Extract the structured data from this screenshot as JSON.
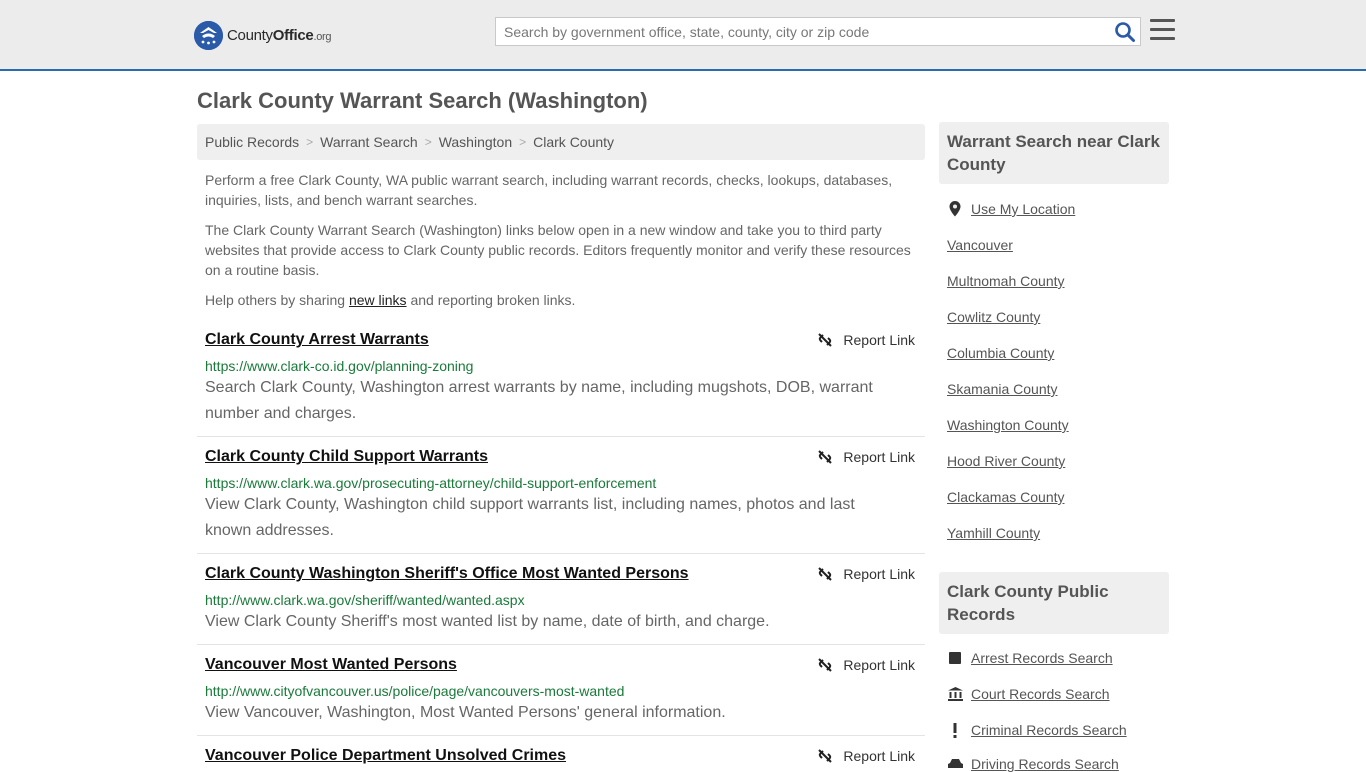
{
  "header": {
    "logo_county": "County",
    "logo_office": "Office",
    "logo_org": ".org",
    "search_placeholder": "Search by government office, state, county, city or zip code"
  },
  "page_title": "Clark County Warrant Search (Washington)",
  "breadcrumb": [
    "Public Records",
    "Warrant Search",
    "Washington",
    "Clark County"
  ],
  "intro": {
    "p1": "Perform a free Clark County, WA public warrant search, including warrant records, checks, lookups, databases, inquiries, lists, and bench warrant searches.",
    "p2": "The Clark County Warrant Search (Washington) links below open in a new window and take you to third party websites that provide access to Clark County public records. Editors frequently monitor and verify these resources on a routine basis.",
    "p3_before": "Help others by sharing ",
    "p3_link": "new links",
    "p3_after": " and reporting broken links."
  },
  "report_label": "Report Link",
  "results": [
    {
      "title": "Clark County Arrest Warrants",
      "url": "https://www.clark-co.id.gov/planning-zoning",
      "desc": "Search Clark County, Washington arrest warrants by name, including mugshots, DOB, warrant number and charges."
    },
    {
      "title": "Clark County Child Support Warrants",
      "url": "https://www.clark.wa.gov/prosecuting-attorney/child-support-enforcement",
      "desc": "View Clark County, Washington child support warrants list, including names, photos and last known addresses."
    },
    {
      "title": "Clark County Washington Sheriff's Office Most Wanted Persons",
      "url": "http://www.clark.wa.gov/sheriff/wanted/wanted.aspx",
      "desc": "View Clark County Sheriff's most wanted list by name, date of birth, and charge."
    },
    {
      "title": "Vancouver Most Wanted Persons",
      "url": "http://www.cityofvancouver.us/police/page/vancouvers-most-wanted",
      "desc": "View Vancouver, Washington, Most Wanted Persons' general information."
    },
    {
      "title": "Vancouver Police Department Unsolved Crimes",
      "url": "",
      "desc": ""
    }
  ],
  "sidebar": {
    "nearby_title": "Warrant Search near Clark County",
    "nearby_links": [
      "Use My Location",
      "Vancouver",
      "Multnomah County",
      "Cowlitz County",
      "Columbia County",
      "Skamania County",
      "Washington County",
      "Hood River County",
      "Clackamas County",
      "Yamhill County"
    ],
    "records_title": "Clark County Public Records",
    "records_links": [
      {
        "label": "Arrest Records Search",
        "icon": "square-icon"
      },
      {
        "label": "Court Records Search",
        "icon": "courthouse-icon"
      },
      {
        "label": "Criminal Records Search",
        "icon": "exclamation-icon"
      },
      {
        "label": "Driving Records Search",
        "icon": "car-icon"
      }
    ]
  },
  "colors": {
    "accent": "#2b6cb0",
    "url_green": "#1a7a3a",
    "header_bg": "#ececec"
  }
}
